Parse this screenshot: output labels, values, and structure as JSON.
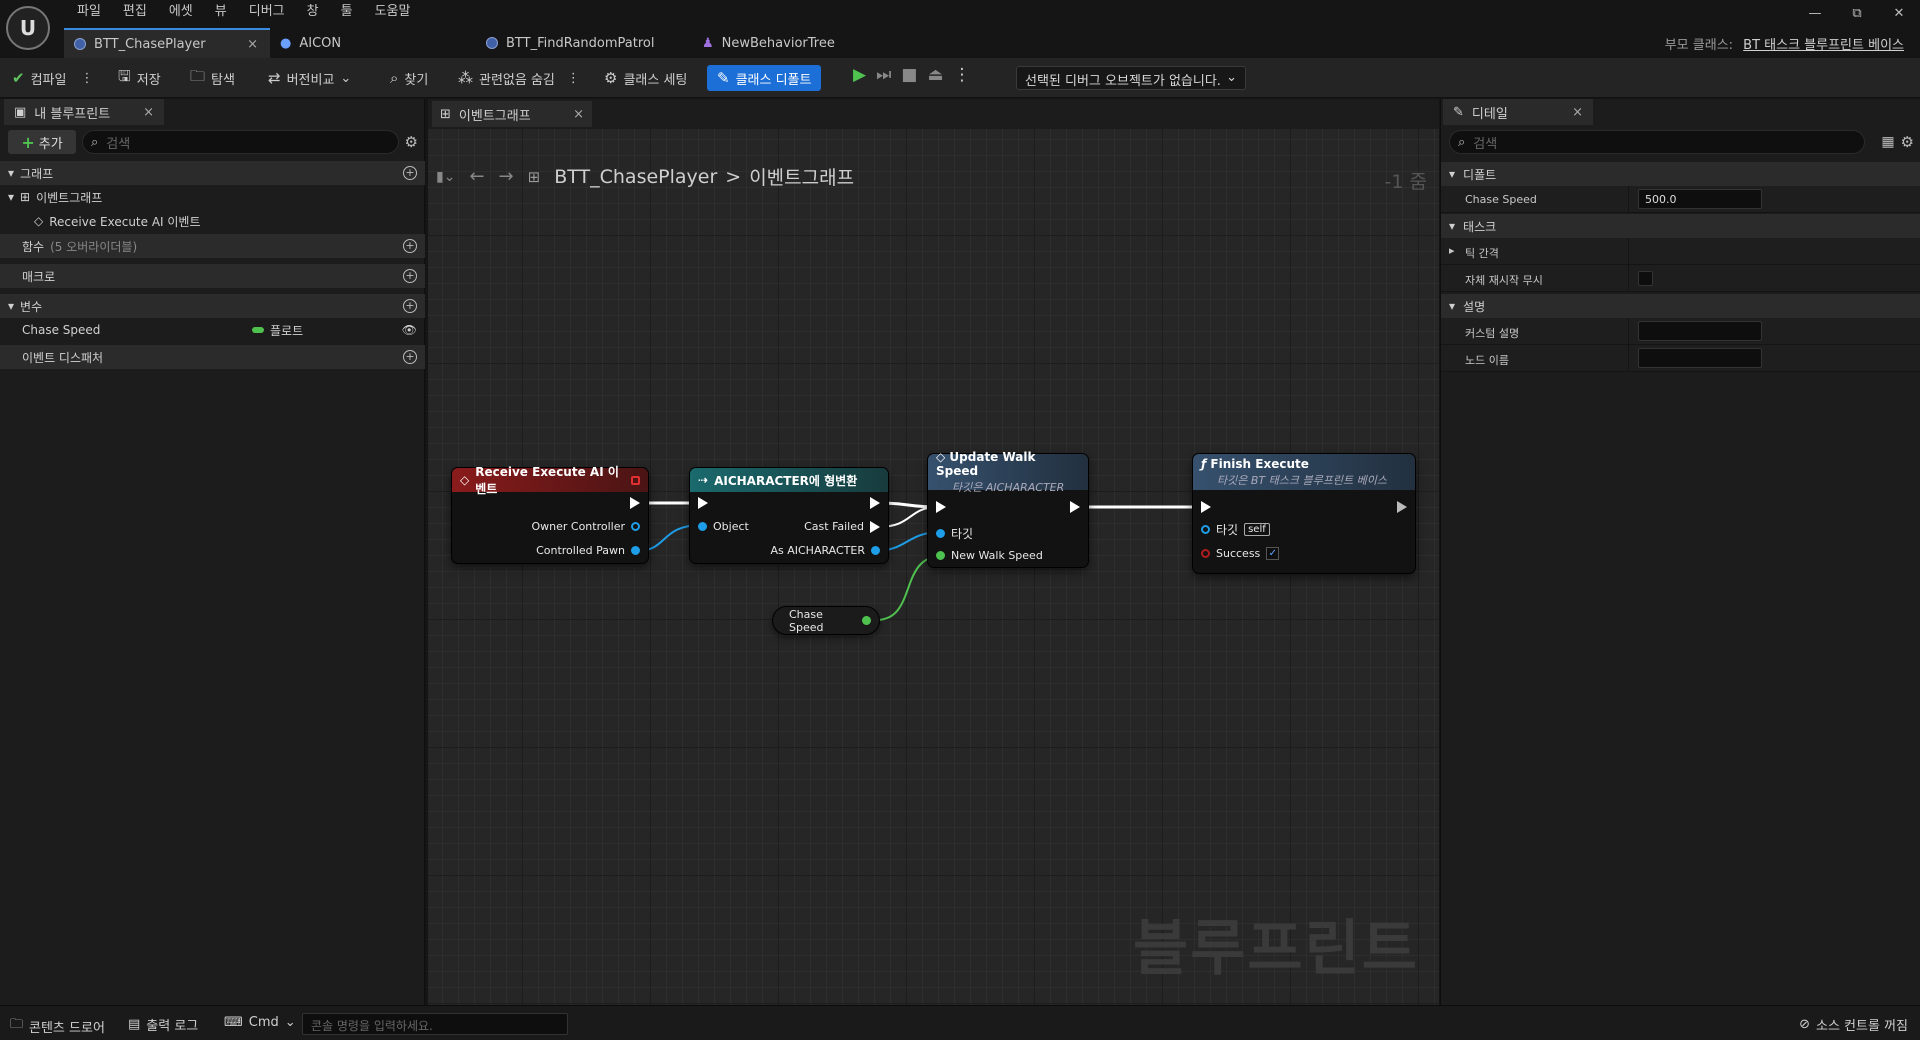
{
  "menu": [
    "파일",
    "편집",
    "에셋",
    "뷰",
    "디버그",
    "창",
    "툴",
    "도움말"
  ],
  "logo": "U",
  "window_controls": [
    "—",
    "⧉",
    "✕"
  ],
  "tabs": [
    {
      "label": "BTT_ChasePlayer",
      "close": "×"
    },
    {
      "label": "AICON"
    },
    {
      "label": "BTT_FindRandomPatrol"
    },
    {
      "label": "NewBehaviorTree"
    }
  ],
  "parent_class": {
    "label": "부모 클래스:",
    "value": "BT 태스크 블루프린트 베이스"
  },
  "toolbar": {
    "compile": "컴파일",
    "save": "저장",
    "browse": "탐색",
    "diff": "버전비교",
    "find": "찾기",
    "hide_unrelated": "관련없음 숨김",
    "class_settings": "클래스 세팅",
    "class_defaults": "클래스 디폴트",
    "debug_object": "선택된 디버그 오브젝트가 없습니다."
  },
  "my_blueprint": {
    "tab": "내 블루프린트",
    "add": "추가",
    "search_placeholder": "검색",
    "sections": {
      "graphs": "그래프",
      "event_graph": "이벤트그래프",
      "event_item": "Receive Execute AI 이벤트",
      "functions": "함수",
      "functions_note": "(5 오버라이더블)",
      "macros": "매크로",
      "variables": "변수",
      "dispatchers": "이벤트 디스패처"
    },
    "variable": {
      "name": "Chase Speed",
      "type": "플로트",
      "type_color": "#4fc14f"
    }
  },
  "graph": {
    "tab": "이벤트그래프",
    "breadcrumb_root": "BTT_ChasePlayer",
    "breadcrumb_sep": ">",
    "breadcrumb_leaf": "이벤트그래프",
    "zoom": "-1 줌",
    "watermark": "블루프린트",
    "nodes": {
      "event": {
        "title": "Receive Execute AI 이벤트",
        "pins": [
          "Owner Controller",
          "Controlled Pawn"
        ],
        "color": "#8a1b1b"
      },
      "cast": {
        "title": "AICHARACTER에 형변환",
        "pins": [
          "Object",
          "Cast Failed",
          "As AICHARACTER"
        ],
        "color": "#1a6a6e"
      },
      "update": {
        "title": "Update Walk Speed",
        "subtitle": "타깃은 AICHARACTER",
        "pins": [
          "타깃",
          "New Walk Speed"
        ],
        "color": "#36516e"
      },
      "finish": {
        "title": "Finish Execute",
        "subtitle": "타깃은 BT 태스크 블루프린트 베이스",
        "pins": [
          "타깃",
          "self",
          "Success"
        ],
        "color": "#36516e"
      },
      "var": {
        "label": "Chase Speed"
      }
    }
  },
  "details": {
    "tab": "디테일",
    "search_placeholder": "검색",
    "sections": {
      "default": "디폴트",
      "task": "태스크",
      "description": "설명"
    },
    "rows": {
      "chase_speed": {
        "label": "Chase Speed",
        "value": "500.0"
      },
      "tick_interval": "틱 간격",
      "ignore_restart": "자체 재시작 무시",
      "custom_desc": "커스텀 설명",
      "node_name": "노드 이름"
    }
  },
  "bottom": {
    "content_drawer": "콘텐츠 드로어",
    "output_log": "출력 로그",
    "cmd": "Cmd",
    "console_placeholder": "콘솔 명령을 입력하세요.",
    "source_control": "소스 컨트롤 꺼짐"
  },
  "colors": {
    "accent": "#1c6fd6",
    "exec_wire": "#ffffff",
    "object_pin": "#1e9ee8",
    "float_pin": "#4fc14f"
  }
}
